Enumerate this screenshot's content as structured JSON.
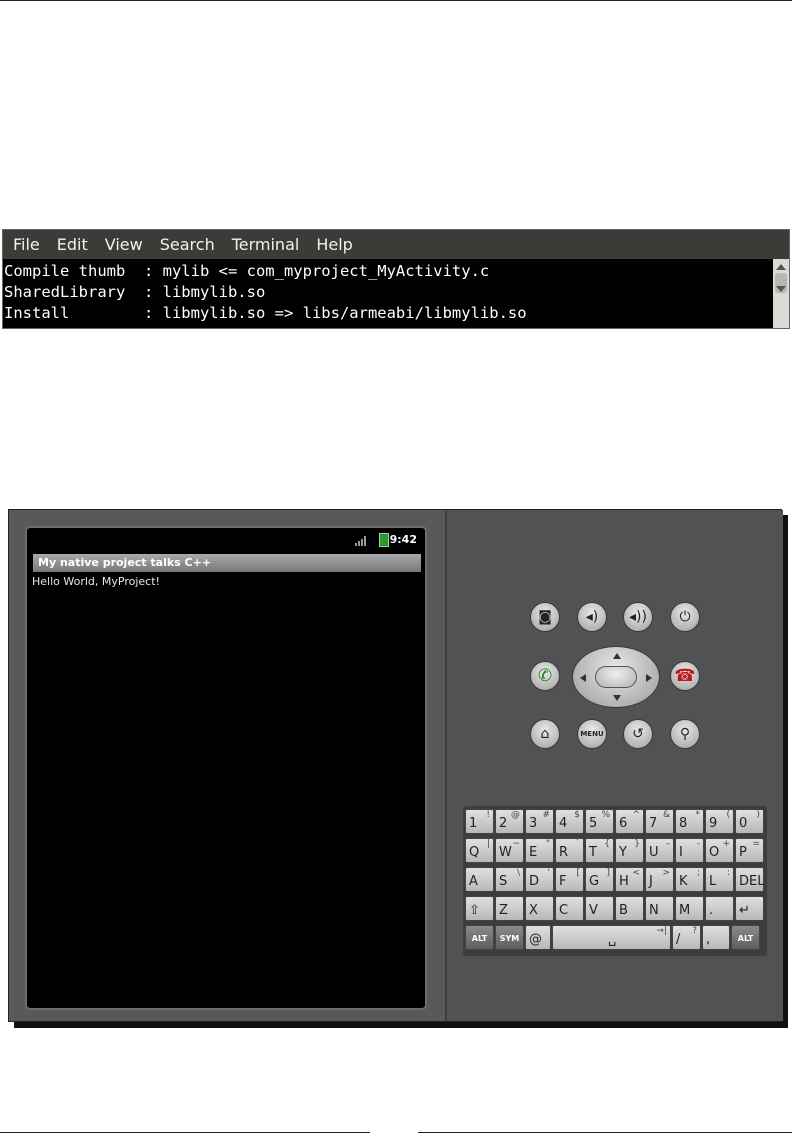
{
  "terminal": {
    "menu": [
      "File",
      "Edit",
      "View",
      "Search",
      "Terminal",
      "Help"
    ],
    "lines": [
      "Compile thumb  : mylib <= com_myproject_MyActivity.c",
      "SharedLibrary  : libmylib.so",
      "Install        : libmylib.so => libs/armeabi/libmylib.so"
    ]
  },
  "emulator": {
    "status_time": "9:42",
    "title": "My native project talks C++",
    "text": "Hello World, MyProject!",
    "menu_button_label": "MENU",
    "keyboard": {
      "row1": [
        {
          "m": "1",
          "s": "!"
        },
        {
          "m": "2",
          "s": "@"
        },
        {
          "m": "3",
          "s": "#"
        },
        {
          "m": "4",
          "s": "$"
        },
        {
          "m": "5",
          "s": "%"
        },
        {
          "m": "6",
          "s": "^"
        },
        {
          "m": "7",
          "s": "&"
        },
        {
          "m": "8",
          "s": "*"
        },
        {
          "m": "9",
          "s": "("
        },
        {
          "m": "0",
          "s": ")"
        }
      ],
      "row2": [
        {
          "m": "Q",
          "s": "|"
        },
        {
          "m": "W",
          "s": "~"
        },
        {
          "m": "E",
          "s": "\""
        },
        {
          "m": "R",
          "s": "`"
        },
        {
          "m": "T",
          "s": "{"
        },
        {
          "m": "Y",
          "s": "}"
        },
        {
          "m": "U",
          "s": "–"
        },
        {
          "m": "I",
          "s": "-"
        },
        {
          "m": "O",
          "s": "+"
        },
        {
          "m": "P",
          "s": "="
        }
      ],
      "row3": [
        {
          "m": "A",
          "s": ""
        },
        {
          "m": "S",
          "s": "\\"
        },
        {
          "m": "D",
          "s": "'"
        },
        {
          "m": "F",
          "s": "["
        },
        {
          "m": "G",
          "s": "]"
        },
        {
          "m": "H",
          "s": "<"
        },
        {
          "m": "J",
          "s": ">"
        },
        {
          "m": "K",
          "s": ";"
        },
        {
          "m": "L",
          "s": ":"
        },
        {
          "m": "DEL",
          "s": ""
        }
      ],
      "row4": [
        {
          "m": "⇧",
          "s": ""
        },
        {
          "m": "Z",
          "s": ""
        },
        {
          "m": "X",
          "s": ""
        },
        {
          "m": "C",
          "s": ""
        },
        {
          "m": "V",
          "s": ""
        },
        {
          "m": "B",
          "s": ""
        },
        {
          "m": "N",
          "s": ""
        },
        {
          "m": "M",
          "s": ""
        },
        {
          "m": ".",
          "s": ""
        },
        {
          "m": "↵",
          "s": ""
        }
      ],
      "row5": [
        {
          "m": "ALT",
          "s": ""
        },
        {
          "m": "SYM",
          "s": ""
        },
        {
          "m": "@",
          "s": ""
        },
        {
          "m": "␣",
          "s": "→|"
        },
        {
          "m": "/",
          "s": "?"
        },
        {
          "m": ",",
          "s": ""
        },
        {
          "m": "ALT",
          "s": ""
        }
      ]
    }
  }
}
